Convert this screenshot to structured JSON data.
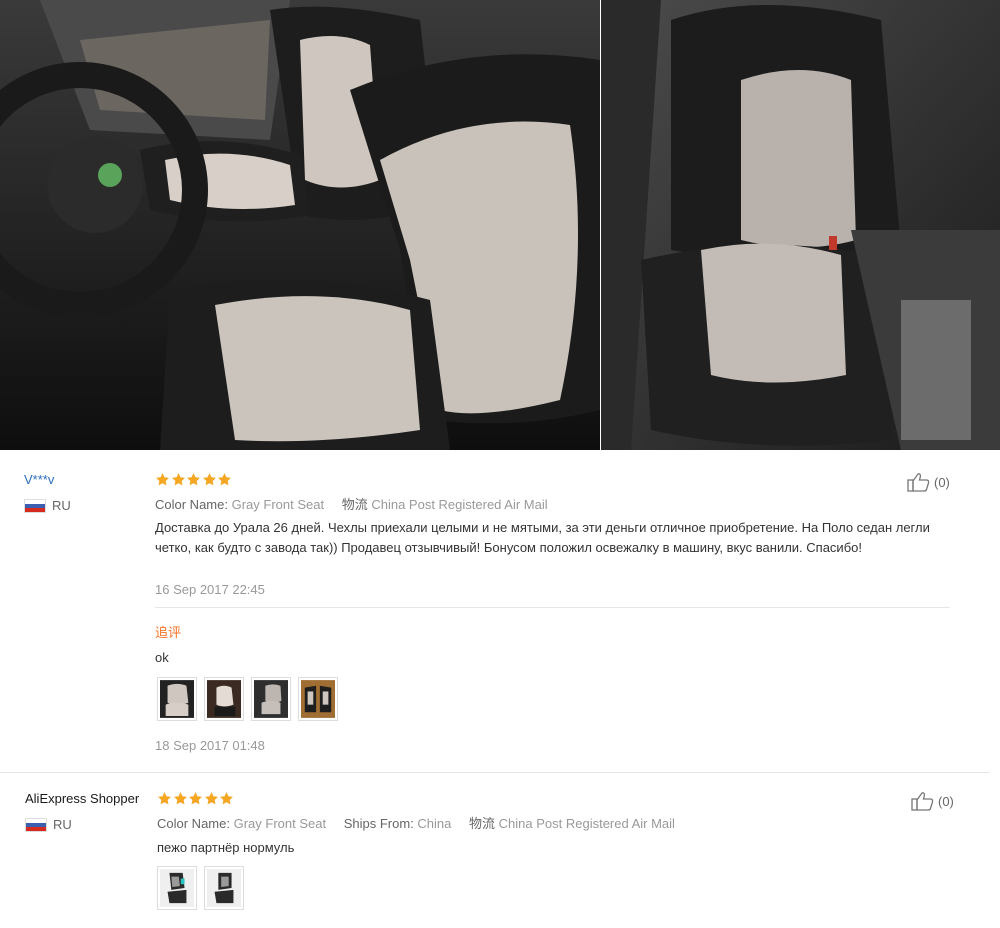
{
  "photos": {
    "left": {
      "alt": "car-front-seats-photo"
    },
    "right": {
      "alt": "car-front-seat-photo"
    }
  },
  "colors": {
    "star": "#f5a623",
    "followup": "#f57224",
    "name_link": "#2a6ebb"
  },
  "reviews": [
    {
      "buyer": "V***v",
      "country": "RU",
      "stars": 5,
      "attrs": [
        {
          "key": "Color Name:",
          "value": "Gray Front Seat"
        },
        {
          "key": "物流",
          "value": "China Post Registered Air Mail"
        }
      ],
      "text": "Доставка до Урала 26 дней. Чехлы приехали целыми и не мятыми, за эти деньги отличное приобретение. На Поло седан легли четко, как будто с завода так)) Продавец отзывчивый! Бонусом положил освежалку в машину, вкус ванили. Спасибо!",
      "date": "16 Sep 2017 22:45",
      "helpful": "(0)",
      "followup": {
        "label": "追评",
        "text": "ok",
        "date": "18 Sep 2017 01:48",
        "images": [
          "thumb-seat-1",
          "thumb-seat-2",
          "thumb-seat-3",
          "thumb-seat-4"
        ]
      }
    },
    {
      "buyer": "AliExpress Shopper",
      "country": "RU",
      "stars": 5,
      "attrs": [
        {
          "key": "Color Name:",
          "value": "Gray Front Seat"
        },
        {
          "key": "Ships From:",
          "value": "China"
        },
        {
          "key": "物流",
          "value": "China Post Registered Air Mail"
        }
      ],
      "text": "пежо партнёр нормуль",
      "helpful": "(0)",
      "images": [
        "thumb-seat-a",
        "thumb-seat-b"
      ]
    }
  ]
}
